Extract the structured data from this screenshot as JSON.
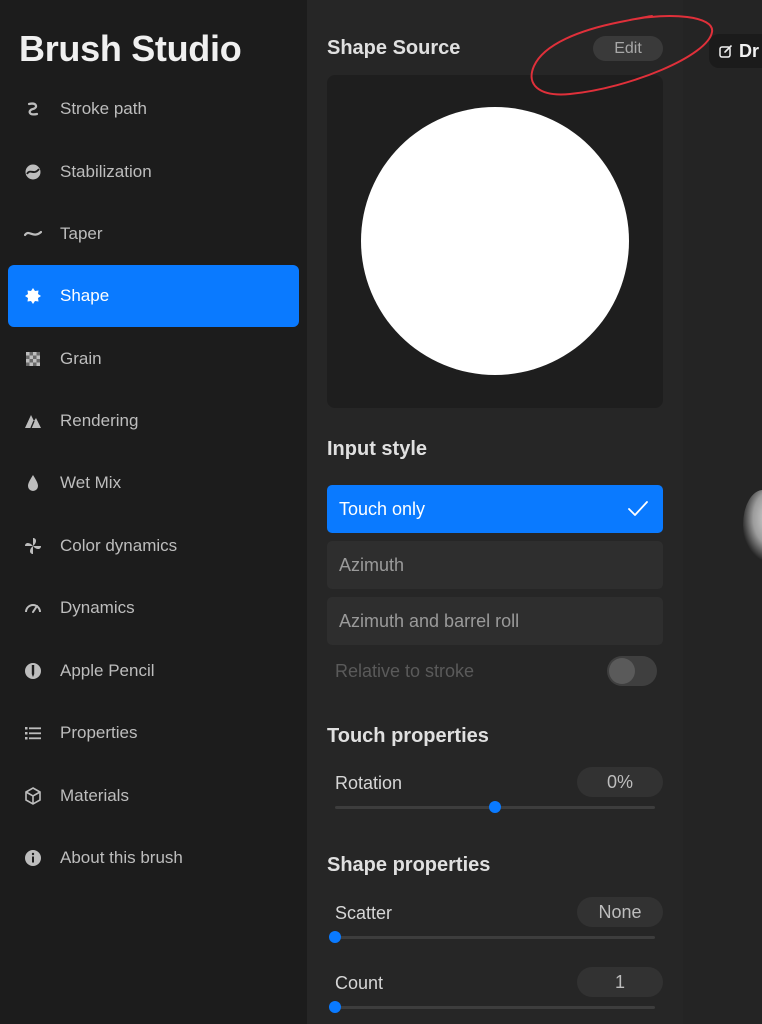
{
  "sidebar": {
    "title": "Brush Studio",
    "items": [
      {
        "label": "Stroke path",
        "icon": "stroke-path-icon",
        "active": false
      },
      {
        "label": "Stabilization",
        "icon": "stabilization-icon",
        "active": false
      },
      {
        "label": "Taper",
        "icon": "taper-icon",
        "active": false
      },
      {
        "label": "Shape",
        "icon": "shape-icon",
        "active": true
      },
      {
        "label": "Grain",
        "icon": "grain-icon",
        "active": false
      },
      {
        "label": "Rendering",
        "icon": "rendering-icon",
        "active": false
      },
      {
        "label": "Wet Mix",
        "icon": "wet-mix-icon",
        "active": false
      },
      {
        "label": "Color dynamics",
        "icon": "color-dynamics-icon",
        "active": false
      },
      {
        "label": "Dynamics",
        "icon": "dynamics-icon",
        "active": false
      },
      {
        "label": "Apple Pencil",
        "icon": "apple-pencil-icon",
        "active": false
      },
      {
        "label": "Properties",
        "icon": "properties-icon",
        "active": false
      },
      {
        "label": "Materials",
        "icon": "materials-icon",
        "active": false
      },
      {
        "label": "About this brush",
        "icon": "info-icon",
        "active": false
      }
    ]
  },
  "shape_source": {
    "title": "Shape Source",
    "edit_label": "Edit"
  },
  "input_style": {
    "title": "Input style",
    "options": [
      {
        "label": "Touch only",
        "selected": true
      },
      {
        "label": "Azimuth",
        "selected": false
      },
      {
        "label": "Azimuth and barrel roll",
        "selected": false
      }
    ],
    "relative_label": "Relative to stroke",
    "relative_enabled": false
  },
  "touch_properties": {
    "title": "Touch properties",
    "rotation": {
      "label": "Rotation",
      "value": "0%",
      "fraction": 0.5
    }
  },
  "shape_properties": {
    "title": "Shape properties",
    "scatter": {
      "label": "Scatter",
      "value": "None",
      "fraction": 0.0
    },
    "count": {
      "label": "Count",
      "value": "1",
      "fraction": 0.0
    }
  },
  "drawing_pad": {
    "tab_label": "Dr"
  },
  "colors": {
    "accent": "#0a7aff",
    "annotation": "#e0303a"
  }
}
